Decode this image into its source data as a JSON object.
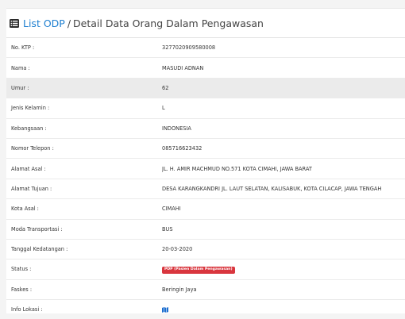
{
  "header": {
    "link_text": "List ODP",
    "separator": "/",
    "title": "Detail Data Orang Dalam Pengawasan"
  },
  "rows": [
    {
      "label": "No. KTP :",
      "value": "3277020909580008"
    },
    {
      "label": "Nama :",
      "value": "MASUDI ADNAN"
    },
    {
      "label": "Umur :",
      "value": "62"
    },
    {
      "label": "Jenis Kelamin :",
      "value": "L"
    },
    {
      "label": "Kebangsaan :",
      "value": "INDONESIA"
    },
    {
      "label": "Nomor Telepon :",
      "value": "085716623432"
    },
    {
      "label": "Alamat Asal :",
      "value": "JL. H. AMIR MACHMUD NO.571 KOTA CIMAHI, JAWA BARAT"
    },
    {
      "label": "Alamat Tujuan :",
      "value": "DESA KARANGKANDRI JL. LAUT SELATAN, KALISABUK, KOTA CILACAP, JAWA TENGAH"
    },
    {
      "label": "Kota Asal :",
      "value": "CIMAHI"
    },
    {
      "label": "Moda Transportasi :",
      "value": "BUS"
    },
    {
      "label": "Tanggal Kedatangan :",
      "value": "20-03-2020"
    },
    {
      "label": "Status :",
      "badge": "PDP (Pasien Dalam Pengawasan)"
    },
    {
      "label": "Faskes :",
      "value": "Beringin Jaya"
    },
    {
      "label": "Info Lokasi :",
      "icon": "map-icon"
    }
  ],
  "colors": {
    "link": "#1e7fd0",
    "badge": "#d9363e",
    "map_icon": "#1e6fd0",
    "shaded_row": "#ebebeb"
  }
}
